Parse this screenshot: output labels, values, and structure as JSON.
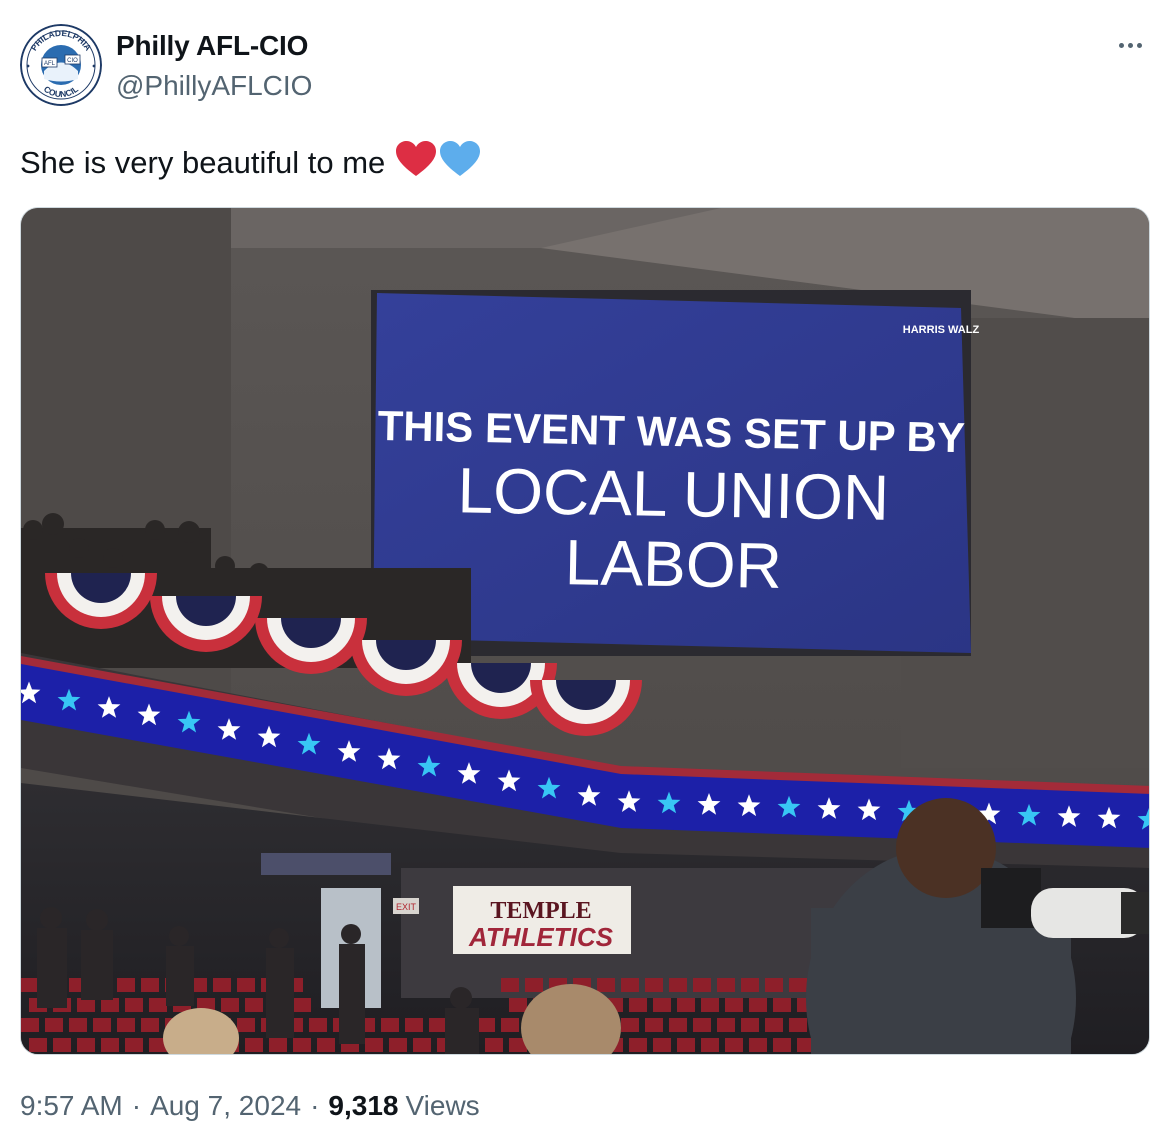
{
  "author": {
    "name": "Philly AFL-CIO",
    "handle": "@PhillyAFLCIO",
    "avatar_text": {
      "top": "PHILADELPHIA",
      "bottom": "COUNCIL",
      "left": "AFL",
      "right": "CIO"
    }
  },
  "tweet": {
    "text": "She is very beautiful to me",
    "emojis": [
      "red-heart",
      "blue-heart"
    ]
  },
  "media": {
    "screen_line1": "THIS EVENT WAS SET UP BY",
    "screen_line2": "LOCAL UNION",
    "screen_line3": "LABOR",
    "screen_corner": "HARRIS WALZ",
    "banner_line1": "TEMPLE",
    "banner_line2": "ATHLETICS",
    "exit_sign": "EXIT",
    "colors": {
      "screen": "#2e3a8e",
      "ribbon": "#1c20a8",
      "star": "#ffffff",
      "star_alt": "#38c6f4"
    }
  },
  "meta": {
    "time": "9:57 AM",
    "date": "Aug 7, 2024",
    "views_count": "9,318",
    "views_label": "Views",
    "separator": "·"
  }
}
